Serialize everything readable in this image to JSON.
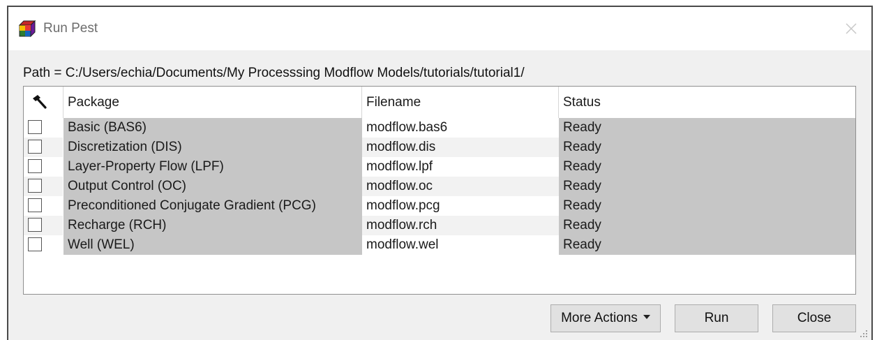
{
  "window": {
    "title": "Run Pest",
    "path_text": "Path = C:/Users/echia/Documents/My Processsing Modflow Models/tutorials/tutorial1/"
  },
  "icons": {
    "app": "colorful-cube-icon",
    "close": "close-icon",
    "header_tool": "hammer-icon",
    "dropdown": "caret-down-icon",
    "resize": "resize-grip-icon"
  },
  "table": {
    "columns": [
      "",
      "Package",
      "Filename",
      "Status"
    ],
    "rows": [
      {
        "checked": false,
        "package": "Basic (BAS6)",
        "filename": "modflow.bas6",
        "status": "Ready"
      },
      {
        "checked": false,
        "package": "Discretization (DIS)",
        "filename": "modflow.dis",
        "status": "Ready"
      },
      {
        "checked": false,
        "package": "Layer-Property Flow (LPF)",
        "filename": "modflow.lpf",
        "status": "Ready"
      },
      {
        "checked": false,
        "package": "Output Control (OC)",
        "filename": "modflow.oc",
        "status": "Ready"
      },
      {
        "checked": false,
        "package": "Preconditioned Conjugate Gradient (PCG)",
        "filename": "modflow.pcg",
        "status": "Ready"
      },
      {
        "checked": false,
        "package": "Recharge (RCH)",
        "filename": "modflow.rch",
        "status": "Ready"
      },
      {
        "checked": false,
        "package": "Well (WEL)",
        "filename": "modflow.wel",
        "status": "Ready"
      }
    ]
  },
  "buttons": {
    "more_actions": "More Actions",
    "run": "Run",
    "close": "Close"
  },
  "colors": {
    "readonly_cell": "#c6c6c6",
    "alt_row": "#f2f2f2",
    "dialog_bg": "#f0f0f0"
  }
}
